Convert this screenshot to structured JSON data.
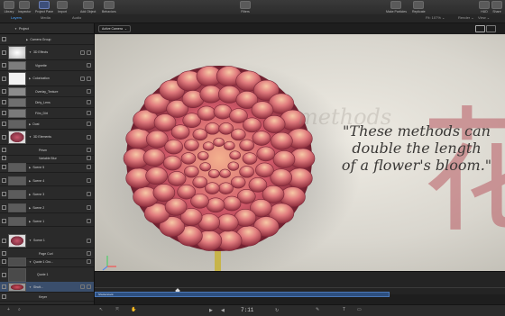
{
  "toolbar": {
    "library_label": "Library",
    "inspector_label": "Inspector",
    "project_pane_label": "Project Pane",
    "import_label": "Import",
    "add_object_label": "Add Object",
    "behaviors_label": "Behaviors",
    "filters_label": "Filters",
    "make_particles_label": "Make Particles",
    "replicate_label": "Replicate",
    "hud_label": "HUD",
    "share_label": "Share"
  },
  "tabs": [
    {
      "label": "Layers"
    },
    {
      "label": "Media"
    },
    {
      "label": "Audio"
    }
  ],
  "viewer": {
    "fit_label": "Fit: 107% ⌄",
    "render_label": "Render ⌄",
    "view_label": "View ⌄",
    "camera_label": "Active Camera"
  },
  "layers": [
    {
      "name": "Project"
    },
    {
      "name": "Camera Group"
    },
    {
      "name": "3D Effects"
    },
    {
      "name": "Vignette"
    },
    {
      "name": "Colorization"
    },
    {
      "name": "Overlay_Texture"
    },
    {
      "name": "Dirty_Lens"
    },
    {
      "name": "Film_Dirt"
    },
    {
      "name": "Dust"
    },
    {
      "name": "3D Elements"
    },
    {
      "name": "Prism"
    },
    {
      "name": "Variable Blur"
    },
    {
      "name": "Scene 5"
    },
    {
      "name": "Scene 4"
    },
    {
      "name": "Scene 3"
    },
    {
      "name": "Scene 2"
    },
    {
      "name": "Scene 1"
    },
    {
      "name": "Scene 1"
    },
    {
      "name": "Page Curl"
    },
    {
      "name": "Quote 1 Gro..."
    },
    {
      "name": "Quote 1"
    },
    {
      "name": "Shutt..."
    },
    {
      "name": "Keyer"
    }
  ],
  "canvas": {
    "quote_line1": "\"These methods can",
    "quote_line2": "double the length",
    "quote_line3": "of a flower's bloom.\"",
    "watermark_glyph": "花",
    "watermark_text": "methods"
  },
  "timeline": {
    "clip_label": "Shutterstock"
  },
  "bottombar": {
    "timecode": "7:11"
  },
  "colors": {
    "accent": "#4aa3ff",
    "selection": "#3a4e6c",
    "timeline_clip": "#2d4f7f"
  }
}
